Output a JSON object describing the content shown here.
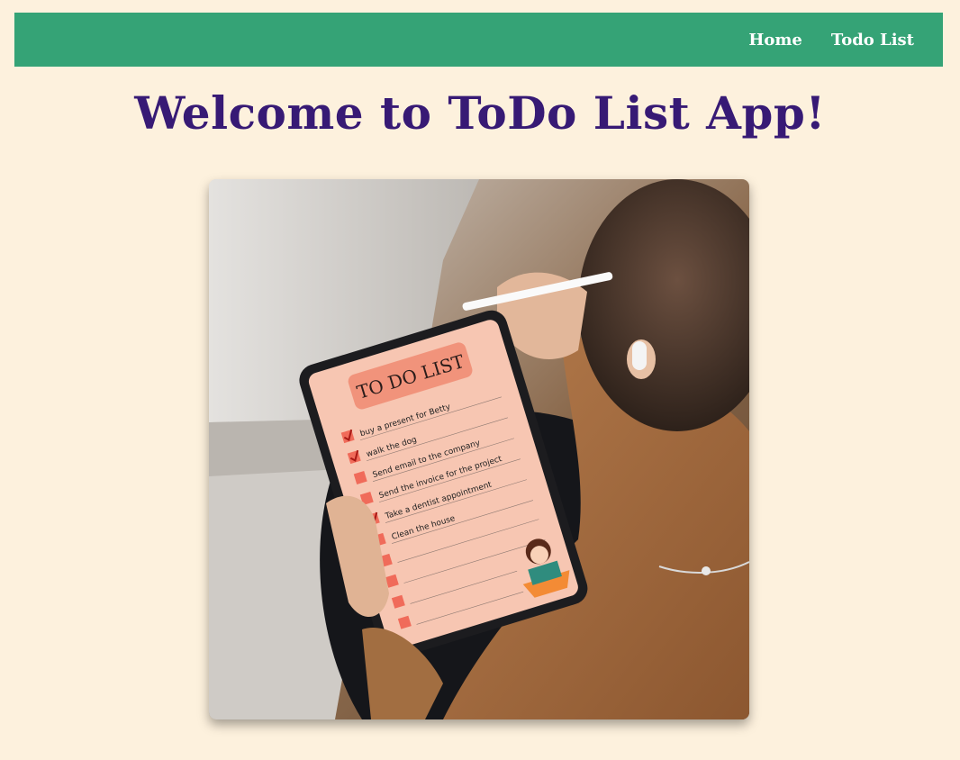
{
  "nav": {
    "links": [
      {
        "label": "Home"
      },
      {
        "label": "Todo List"
      }
    ]
  },
  "page": {
    "title": "Welcome to ToDo List App!"
  },
  "hero": {
    "tablet_heading": "TO DO LIST",
    "tasks": [
      {
        "text": "buy a present for Betty",
        "checked": true
      },
      {
        "text": "walk the dog",
        "checked": true
      },
      {
        "text": "Send email to the company",
        "checked": false
      },
      {
        "text": "Send the invoice for the project",
        "checked": false
      },
      {
        "text": "Take a dentist appointment",
        "checked": true
      },
      {
        "text": "Clean the house",
        "checked": false
      },
      {
        "text": "",
        "checked": false
      },
      {
        "text": "",
        "checked": false
      },
      {
        "text": "",
        "checked": false
      },
      {
        "text": "",
        "checked": false
      }
    ]
  },
  "colors": {
    "background": "#fdf1dd",
    "navbar": "#35a376",
    "title": "#371a75"
  }
}
